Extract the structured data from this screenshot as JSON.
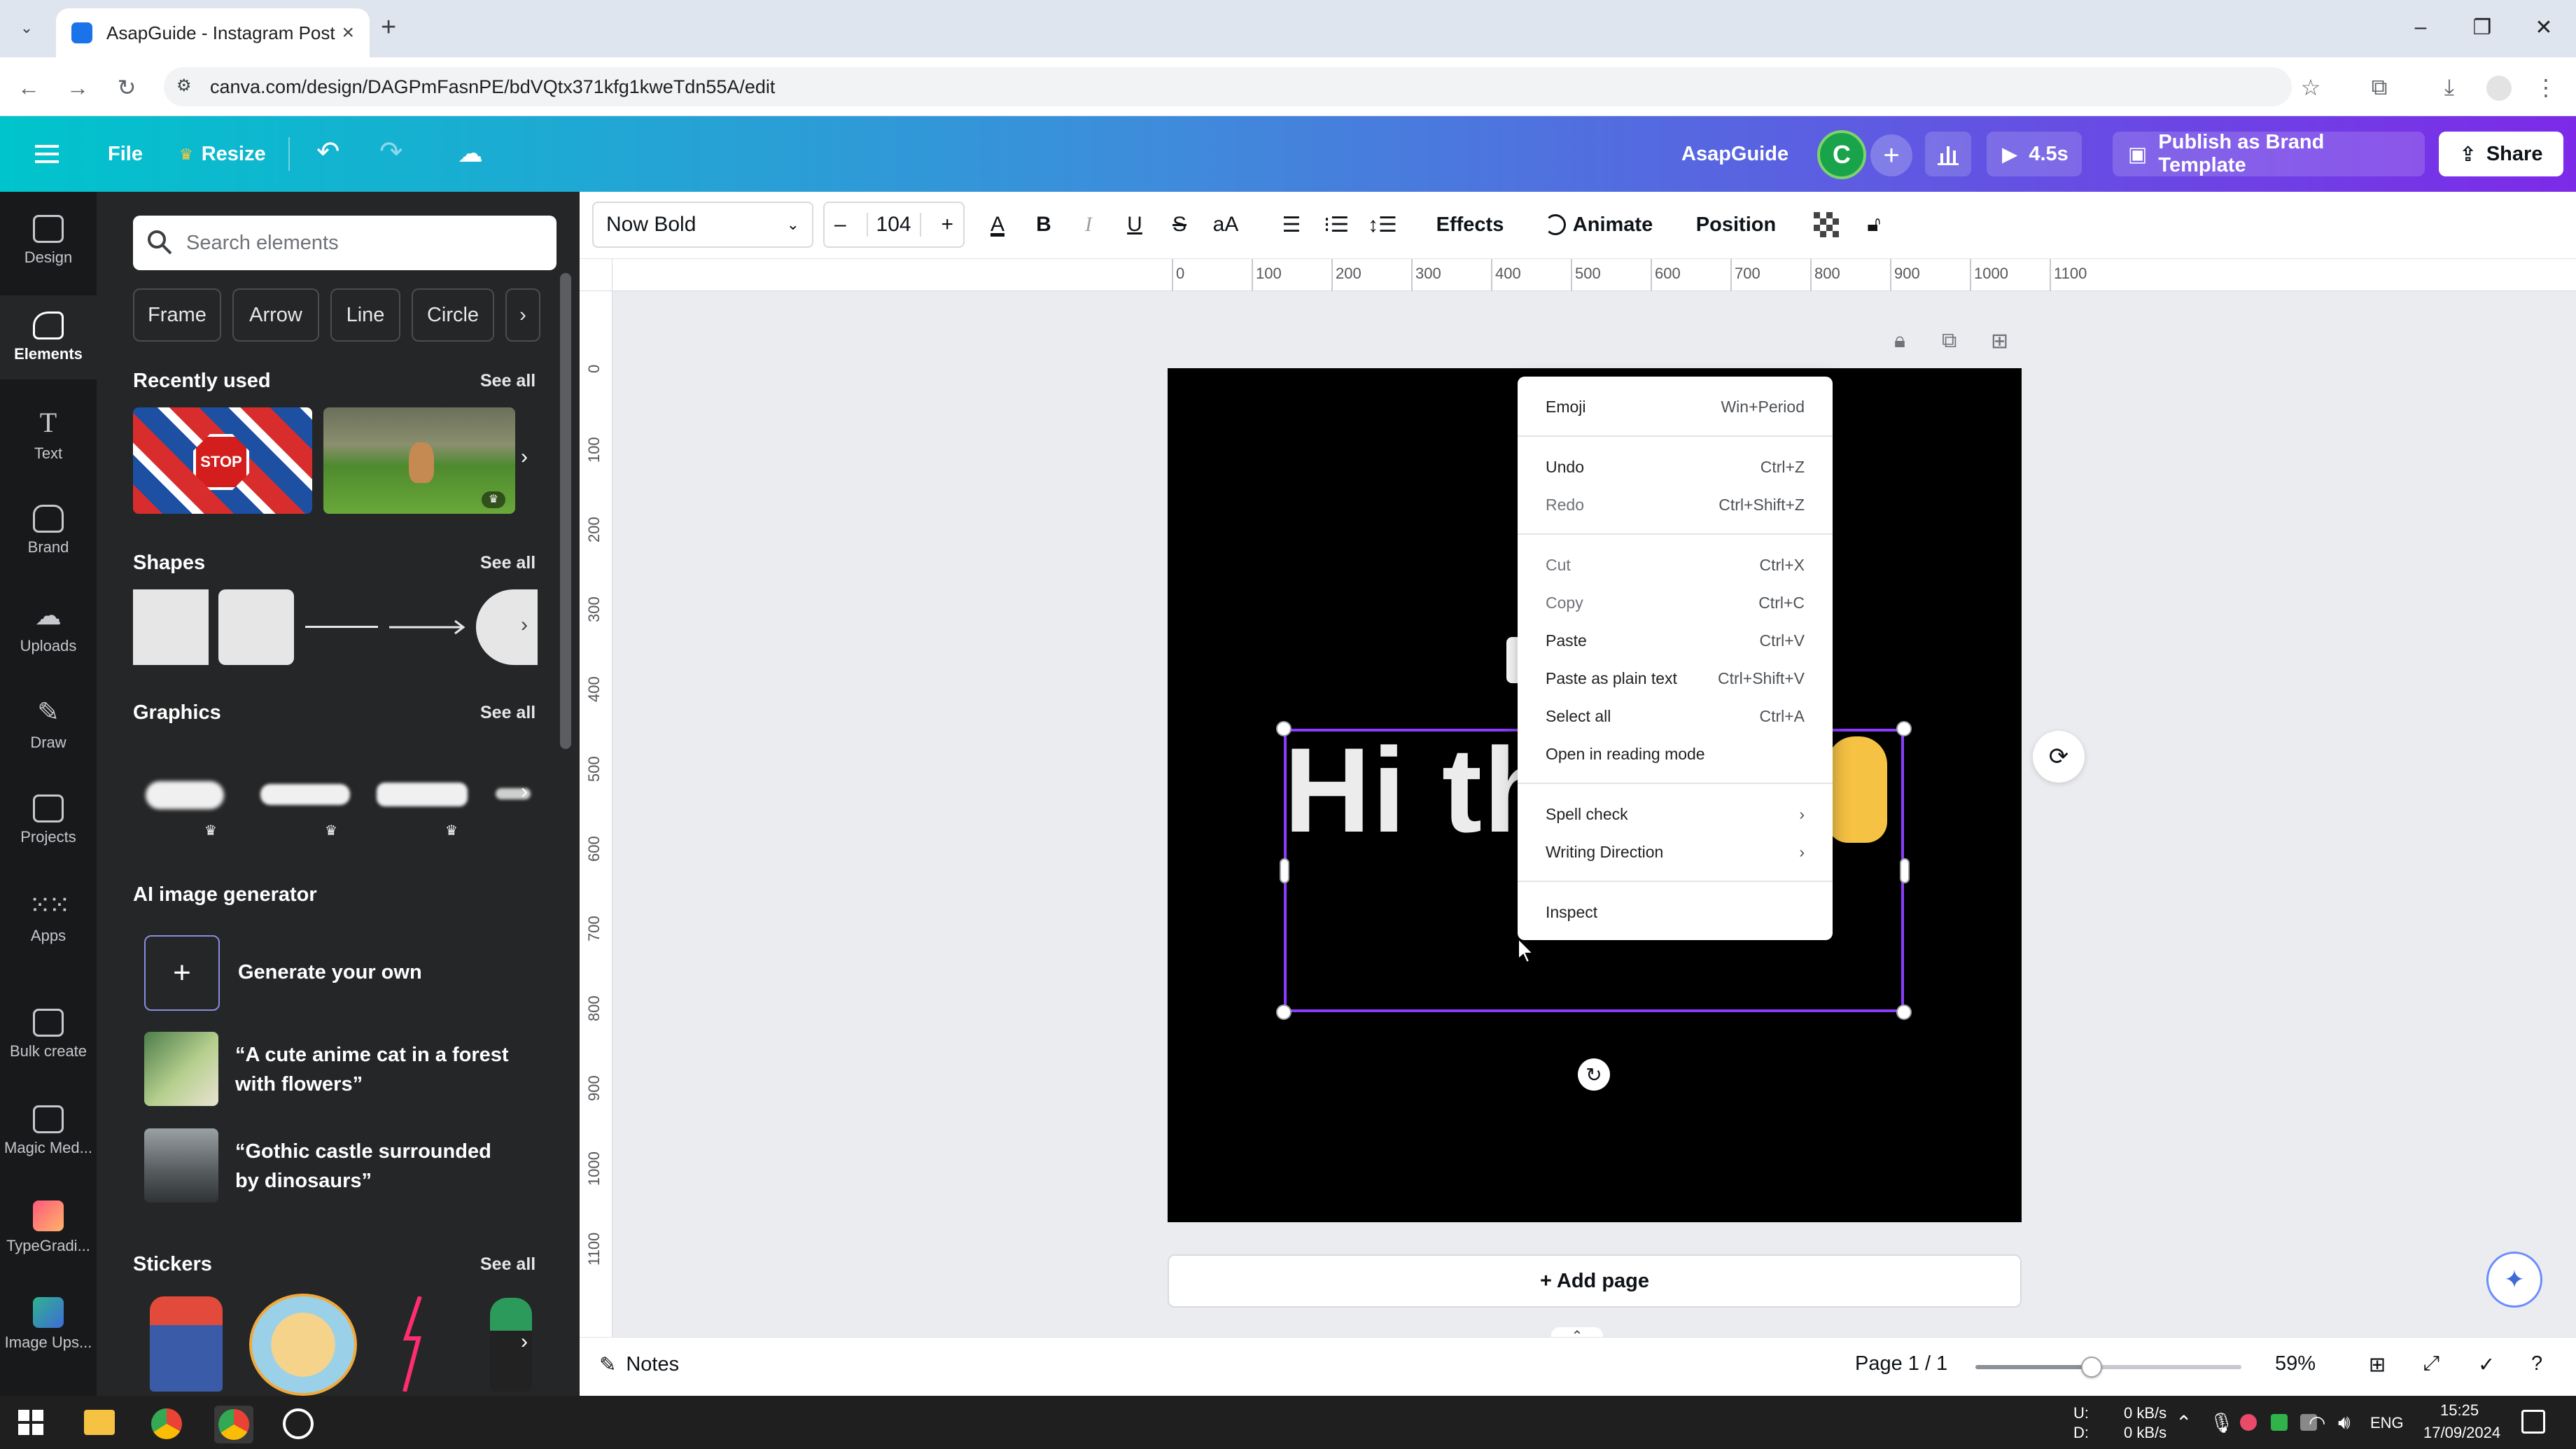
{
  "browser": {
    "tab_title": "AsapGuide - Instagram Post",
    "url": "canva.com/design/DAGPmFasnPE/bdVQtx371kfg1kweTdn55A/edit"
  },
  "header": {
    "file": "File",
    "resize": "Resize",
    "brand": "AsapGuide",
    "avatar_initial": "C",
    "play_time": "4.5s",
    "publish": "Publish as Brand Template",
    "share": "Share"
  },
  "rail": {
    "items": [
      "Design",
      "Elements",
      "Text",
      "Brand",
      "Uploads",
      "Draw",
      "Projects",
      "Apps",
      "Bulk create",
      "Magic Med...",
      "TypeGradi...",
      "Image Ups..."
    ]
  },
  "panel": {
    "search_placeholder": "Search elements",
    "chips": [
      "Frame",
      "Arrow",
      "Line",
      "Circle"
    ],
    "recently_used": "Recently used",
    "stop_sign": "STOP",
    "shapes": "Shapes",
    "graphics": "Graphics",
    "ai_generator": "AI image generator",
    "generate_own": "Generate your own",
    "ai_prompts": [
      "“A cute anime cat in a forest with flowers”",
      "“Gothic castle surrounded by dinosaurs”"
    ],
    "stickers": "Stickers",
    "see_all": "See all"
  },
  "toolbar": {
    "font": "Now Bold",
    "font_size": "104",
    "case_label": "aA",
    "effects": "Effects",
    "animate": "Animate",
    "position": "Position"
  },
  "ruler": {
    "top": [
      "0",
      "100",
      "200",
      "300",
      "400",
      "500",
      "600",
      "700",
      "800",
      "900",
      "1000",
      "1100"
    ],
    "left": [
      "0",
      "100",
      "200",
      "300",
      "400",
      "500",
      "600",
      "700",
      "800",
      "900",
      "1000",
      "1100"
    ]
  },
  "canvas": {
    "headline": "Hi th"
  },
  "context_menu": {
    "items": [
      {
        "label": "Emoji",
        "shortcut": "Win+Period"
      },
      {
        "label": "Undo",
        "shortcut": "Ctrl+Z"
      },
      {
        "label": "Redo",
        "shortcut": "Ctrl+Shift+Z"
      },
      {
        "label": "Cut",
        "shortcut": "Ctrl+X"
      },
      {
        "label": "Copy",
        "shortcut": "Ctrl+C"
      },
      {
        "label": "Paste",
        "shortcut": "Ctrl+V"
      },
      {
        "label": "Paste as plain text",
        "shortcut": "Ctrl+Shift+V"
      },
      {
        "label": "Select all",
        "shortcut": "Ctrl+A"
      },
      {
        "label": "Open in reading mode",
        "shortcut": ""
      },
      {
        "label": "Spell check",
        "shortcut": "›"
      },
      {
        "label": "Writing Direction",
        "shortcut": "›"
      },
      {
        "label": "Inspect",
        "shortcut": ""
      }
    ]
  },
  "footer": {
    "add_page": "+ Add page",
    "notes": "Notes",
    "page": "Page 1 / 1",
    "zoom": "59%",
    "zoom_level": 0.59
  },
  "taskbar": {
    "net_up_label": "U:",
    "net_down_label": "D:",
    "net_up": "0 kB/s",
    "net_down": "0 kB/s",
    "lang": "ENG",
    "time": "15:25",
    "date": "17/09/2024"
  },
  "colors": {
    "accent": "#8b3dff",
    "header_start": "#00c4cc",
    "header_end": "#7d2ae8"
  }
}
